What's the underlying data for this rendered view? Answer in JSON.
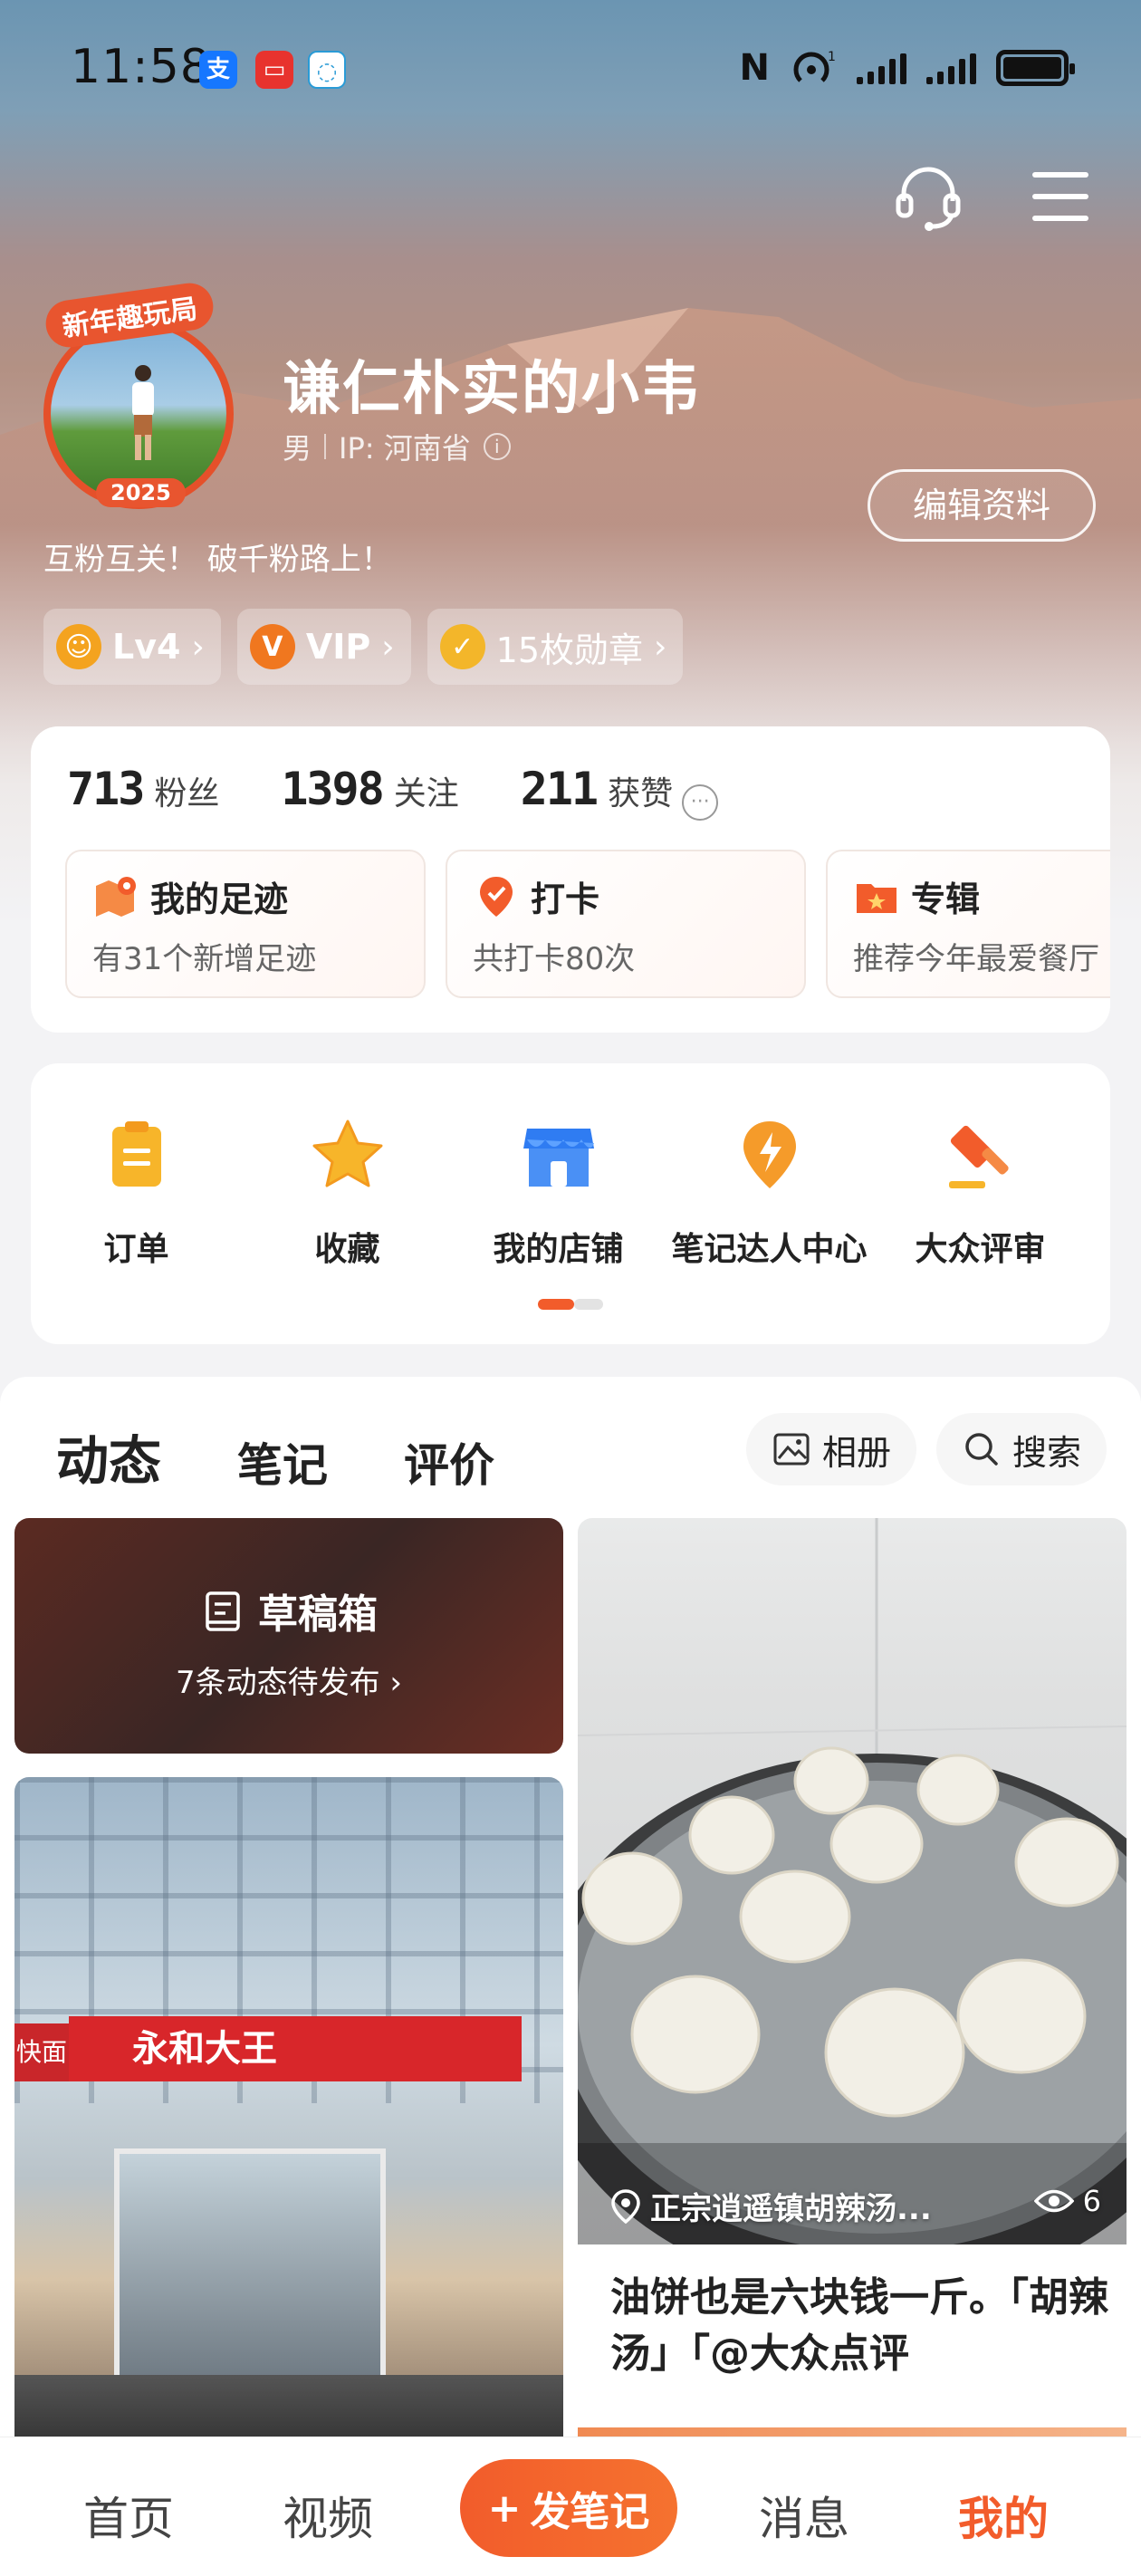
{
  "status_bar": {
    "time": "11:58",
    "app_icons": [
      "alipay-icon",
      "red-app-icon",
      "chat-app-icon"
    ],
    "nfc": "N",
    "signal_label": "1"
  },
  "profile": {
    "username": "谦仁朴实的小韦",
    "gender": "男",
    "ip": "IP: 河南省",
    "bio": "互粉互关！ 破千粉路上！",
    "edit_label": "编辑资料",
    "avatar_badge_top": "新年趣玩局",
    "avatar_badge_year": "2025",
    "chips": [
      {
        "icon": "level-icon",
        "label": "Lv4"
      },
      {
        "icon": "vip-icon",
        "icon_text": "V",
        "label": "VIP"
      },
      {
        "icon": "medal-icon",
        "label": "15枚勋章"
      }
    ]
  },
  "stats": {
    "fans_count": "713",
    "fans_label": "粉丝",
    "following_count": "1398",
    "following_label": "关注",
    "likes_count": "211",
    "likes_label": "获赞"
  },
  "mini_cards": [
    {
      "icon": "footprint-map-icon",
      "title": "我的足迹",
      "subtitle": "有31个新增足迹"
    },
    {
      "icon": "checkin-pin-icon",
      "title": "打卡",
      "subtitle": "共打卡80次"
    },
    {
      "icon": "album-folder-icon",
      "title": "专辑",
      "subtitle": "推荐今年最爱餐厅"
    }
  ],
  "shortcuts": [
    {
      "icon": "order-icon",
      "label": "订单"
    },
    {
      "icon": "star-icon",
      "label": "收藏"
    },
    {
      "icon": "store-icon",
      "label": "我的店铺"
    },
    {
      "icon": "lightning-icon",
      "label": "笔记达人中心"
    },
    {
      "icon": "gavel-icon",
      "label": "大众评审"
    }
  ],
  "feed": {
    "tabs": [
      "动态",
      "笔记",
      "评价"
    ],
    "album_label": "相册",
    "search_label": "搜索",
    "draft": {
      "title": "草稿箱",
      "subtitle": "7条动态待发布"
    },
    "store_sign": "永和大王",
    "store_side_sign": "快面",
    "post": {
      "location": "正宗逍遥镇胡辣汤...",
      "views": "6",
      "caption": "油饼也是六块钱一斤。「胡辣汤」「@大众点评"
    }
  },
  "bottom_nav": {
    "home": "首页",
    "video": "视频",
    "post": "发笔记",
    "messages": "消息",
    "mine": "我的"
  },
  "colors": {
    "accent": "#f25c2b",
    "text_primary": "#222222"
  }
}
